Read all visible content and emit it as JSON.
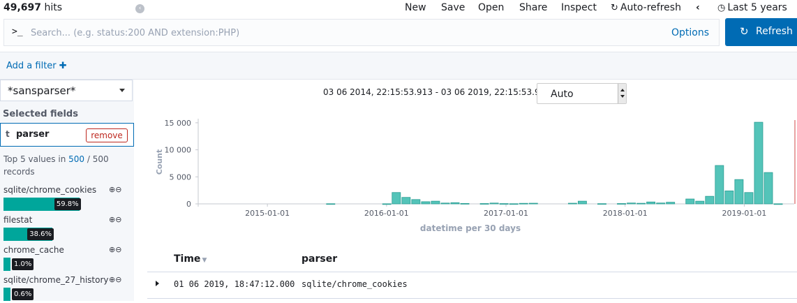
{
  "header": {
    "hits_count": "49,697",
    "hits_label": " hits",
    "menu": [
      "New",
      "Save",
      "Open",
      "Share",
      "Inspect"
    ],
    "auto_refresh": "Auto-refresh",
    "time_range": "Last 5 years"
  },
  "search": {
    "prompt": ">_",
    "placeholder": "Search... (e.g. status:200 AND extension:PHP)",
    "value": "",
    "options_label": "Options",
    "refresh_label": "Refresh"
  },
  "filters": {
    "add_label": "Add a filter"
  },
  "sidebar": {
    "index_pattern": "*sansparser*",
    "selected_title": "Selected fields",
    "field": {
      "type": "t",
      "name": "parser",
      "remove_label": "remove"
    },
    "top_values": {
      "prefix": "Top 5 values in ",
      "sample": "500",
      "sep": " / ",
      "total": "500",
      "suffix": " records"
    },
    "values": [
      {
        "name": "sqlite/chrome_cookies",
        "percent": 59.8,
        "label": "59.8%"
      },
      {
        "name": "filestat",
        "percent": 38.6,
        "label": "38.6%"
      },
      {
        "name": "chrome_cache",
        "percent": 1.0,
        "label": "1.0%"
      },
      {
        "name": "sqlite/chrome_27_history",
        "percent": 0.6,
        "label": "0.6%"
      }
    ]
  },
  "histogram": {
    "range_text": "03 06 2014, 22:15:53.913 - 03 06 2019, 22:15:53.914 —",
    "interval": "Auto"
  },
  "chart_data": {
    "type": "bar",
    "xlabel": "datetime per 30 days",
    "ylabel": "Count",
    "ylim": [
      0,
      15500
    ],
    "y_ticks": [
      "0",
      "5 000",
      "10 000",
      "15 000"
    ],
    "x_ticks": [
      "2015-01-01",
      "2016-01-01",
      "2017-01-01",
      "2018-01-01",
      "2019-01-01"
    ],
    "x_range": [
      "2014-06-03",
      "2019-06-03"
    ],
    "bars": [
      {
        "x": "2015-07-01",
        "y": 30
      },
      {
        "x": "2015-12-20",
        "y": 20
      },
      {
        "x": "2016-01-18",
        "y": 2100
      },
      {
        "x": "2016-02-17",
        "y": 1200
      },
      {
        "x": "2016-03-18",
        "y": 800
      },
      {
        "x": "2016-04-17",
        "y": 400
      },
      {
        "x": "2016-05-17",
        "y": 500
      },
      {
        "x": "2016-06-16",
        "y": 150
      },
      {
        "x": "2016-07-16",
        "y": 220
      },
      {
        "x": "2016-08-15",
        "y": 80
      },
      {
        "x": "2016-10-14",
        "y": 60
      },
      {
        "x": "2016-11-13",
        "y": 150
      },
      {
        "x": "2016-12-13",
        "y": 50
      },
      {
        "x": "2017-01-12",
        "y": 30
      },
      {
        "x": "2017-02-11",
        "y": 100
      },
      {
        "x": "2017-03-13",
        "y": 120
      },
      {
        "x": "2017-07-11",
        "y": 120
      },
      {
        "x": "2017-08-10",
        "y": 500
      },
      {
        "x": "2017-10-09",
        "y": 40
      },
      {
        "x": "2017-12-08",
        "y": 60
      },
      {
        "x": "2018-01-07",
        "y": 160
      },
      {
        "x": "2018-02-06",
        "y": 110
      },
      {
        "x": "2018-03-08",
        "y": 350
      },
      {
        "x": "2018-04-07",
        "y": 160
      },
      {
        "x": "2018-05-07",
        "y": 300
      },
      {
        "x": "2018-07-06",
        "y": 900
      },
      {
        "x": "2018-08-05",
        "y": 500
      },
      {
        "x": "2018-09-04",
        "y": 1400
      },
      {
        "x": "2018-10-04",
        "y": 7100
      },
      {
        "x": "2018-11-03",
        "y": 2400
      },
      {
        "x": "2018-12-03",
        "y": 4500
      },
      {
        "x": "2019-01-02",
        "y": 2100
      },
      {
        "x": "2019-02-01",
        "y": 15100
      },
      {
        "x": "2019-03-03",
        "y": 5800
      },
      {
        "x": "2019-04-02",
        "y": 20
      }
    ]
  },
  "table": {
    "columns": [
      "Time",
      "parser"
    ],
    "rows": [
      {
        "time": "01 06 2019, 18:47:12.000",
        "parser": "sqlite/chrome_cookies"
      }
    ]
  },
  "colors": {
    "accent": "#006bb4",
    "bar": "#54c4b9",
    "bar_stroke": "#2a9d93",
    "field_bar": "#00a69b",
    "danger": "#bd271e"
  }
}
